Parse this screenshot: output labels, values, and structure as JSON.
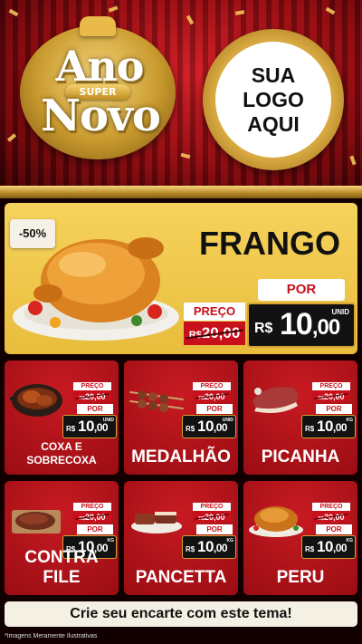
{
  "header": {
    "badge_top": "Ano",
    "badge_middle": "SUPER",
    "badge_bottom": "Novo",
    "logo_line1": "SUA",
    "logo_line2": "LOGO",
    "logo_line3": "AQUI"
  },
  "featured": {
    "discount": "-50%",
    "title": "FRANGO",
    "preco_label": "PREÇO",
    "old_currency": "R$",
    "old_value": "20,00",
    "por_label": "POR",
    "new_currency": "R$",
    "new_value": "10",
    "new_cents": ",00",
    "unit": "UNID"
  },
  "products": [
    {
      "name": "COXA E SOBRECOXA",
      "preco_label": "PREÇO",
      "old_currency": "R$",
      "old_value": "20,00",
      "por_label": "POR",
      "new_currency": "R$",
      "new_value": "10",
      "new_cents": ",00",
      "unit": "UNID"
    },
    {
      "name": "MEDALHÃO",
      "preco_label": "PREÇO",
      "old_currency": "R$",
      "old_value": "20,00",
      "por_label": "POR",
      "new_currency": "R$",
      "new_value": "10",
      "new_cents": ",00",
      "unit": "UNID"
    },
    {
      "name": "PICANHA",
      "preco_label": "PREÇO",
      "old_currency": "R$",
      "old_value": "20,00",
      "por_label": "POR",
      "new_currency": "R$",
      "new_value": "10",
      "new_cents": ",00",
      "unit": "KG"
    },
    {
      "name": "CONTRA FILE",
      "preco_label": "PREÇO",
      "old_currency": "R$",
      "old_value": "20,00",
      "por_label": "POR",
      "new_currency": "R$",
      "new_value": "10",
      "new_cents": ",00",
      "unit": "KG"
    },
    {
      "name": "PANCETTA",
      "preco_label": "PREÇO",
      "old_currency": "R$",
      "old_value": "20,00",
      "por_label": "POR",
      "new_currency": "R$",
      "new_value": "10",
      "new_cents": ",00",
      "unit": "KG"
    },
    {
      "name": "PERU",
      "preco_label": "PREÇO",
      "old_currency": "R$",
      "old_value": "20,00",
      "por_label": "POR",
      "new_currency": "R$",
      "new_value": "10",
      "new_cents": ",00",
      "unit": "KG"
    }
  ],
  "footer": {
    "cta": "Crie seu encarte com este tema!",
    "disclaimer": "*Imagens Meramente Ilustrativas"
  },
  "colors": {
    "brand_red": "#c8101c",
    "gold": "#d4a435",
    "featured_yellow": "#f6d25c",
    "card_red": "#b8141c"
  }
}
